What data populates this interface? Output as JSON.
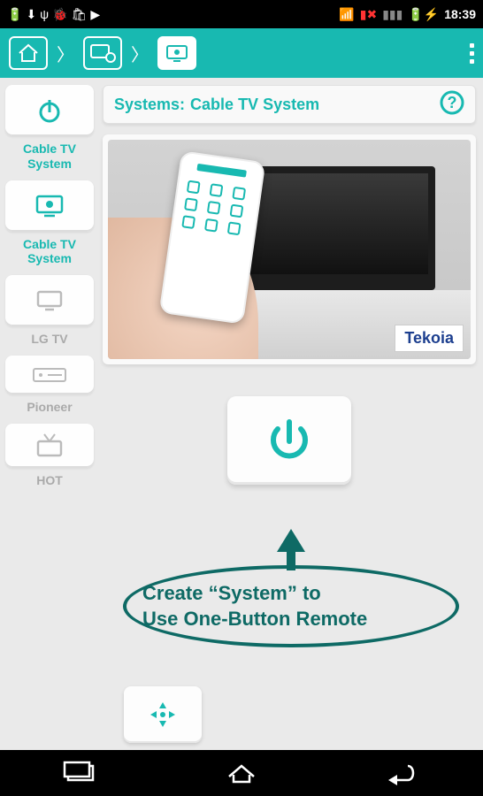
{
  "status": {
    "time": "18:39"
  },
  "header": {
    "nav": [
      "home",
      "devices",
      "remote"
    ]
  },
  "sidebar": {
    "items": [
      {
        "icon": "power",
        "label": "Cable TV\nSystem",
        "active": true
      },
      {
        "icon": "tv-gear",
        "label": "Cable TV\nSystem",
        "active": true
      },
      {
        "icon": "tv",
        "label": "LG TV",
        "active": false
      },
      {
        "icon": "receiver",
        "label": "Pioneer",
        "active": false
      },
      {
        "icon": "tv-antenna",
        "label": "HOT",
        "active": false
      }
    ]
  },
  "systems_bar": {
    "prefix": "Systems:",
    "name": "Cable TV System"
  },
  "preview": {
    "brand": "Tekoia"
  },
  "annotation": {
    "line1": "Create “System” to",
    "line2": "Use One-Button Remote"
  }
}
